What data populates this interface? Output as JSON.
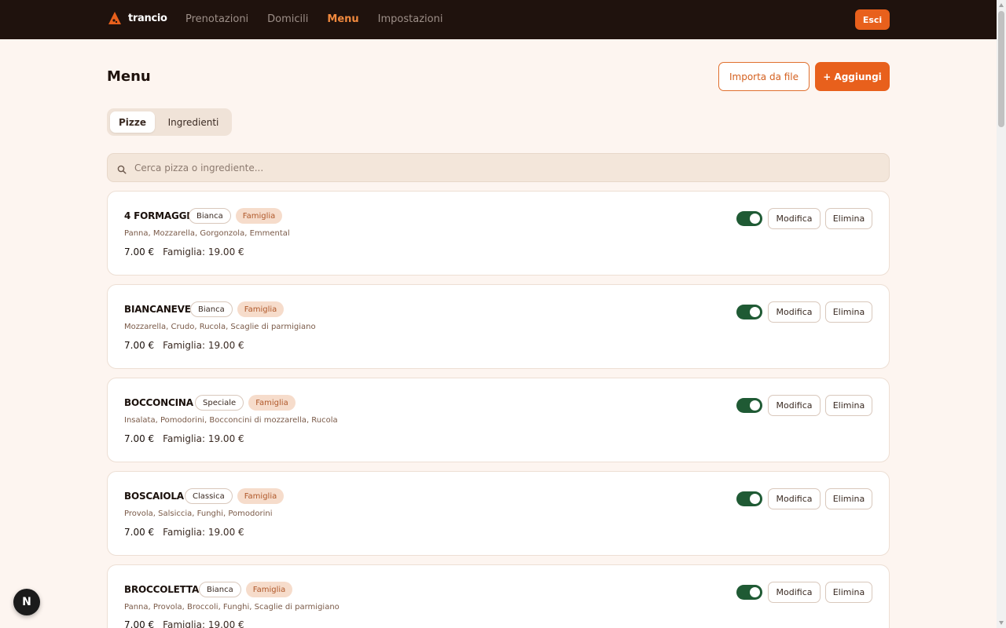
{
  "brand": {
    "name": "trancio",
    "accent": "#e8601c"
  },
  "nav": {
    "items": [
      {
        "label": "Prenotazioni",
        "active": false
      },
      {
        "label": "Domicili",
        "active": false
      },
      {
        "label": "Menu",
        "active": true
      },
      {
        "label": "Impostazioni",
        "active": false
      }
    ],
    "logout_label": "Esci"
  },
  "page": {
    "title": "Menu",
    "import_label": "Importa da file",
    "add_label": "+ Aggiungi"
  },
  "tabs": [
    {
      "label": "Pizze",
      "selected": true
    },
    {
      "label": "Ingredienti",
      "selected": false
    }
  ],
  "search": {
    "placeholder": "Cerca pizza o ingrediente...",
    "value": ""
  },
  "pizzas": [
    {
      "name": "4 FORMAGGI",
      "category": "Bianca",
      "family_badge": "Famiglia",
      "ingredients": "Panna, Mozzarella, Gorgonzola, Emmental",
      "price": "7.00 €",
      "family_price": "Famiglia: 19.00 €",
      "enabled": true,
      "edit_label": "Modifica",
      "delete_label": "Elimina"
    },
    {
      "name": "BIANCANEVE",
      "category": "Bianca",
      "family_badge": "Famiglia",
      "ingredients": "Mozzarella, Crudo, Rucola, Scaglie di parmigiano",
      "price": "7.00 €",
      "family_price": "Famiglia: 19.00 €",
      "enabled": true,
      "edit_label": "Modifica",
      "delete_label": "Elimina"
    },
    {
      "name": "BOCCONCINA",
      "category": "Speciale",
      "family_badge": "Famiglia",
      "ingredients": "Insalata, Pomodorini, Bocconcini di mozzarella, Rucola",
      "price": "7.00 €",
      "family_price": "Famiglia: 19.00 €",
      "enabled": true,
      "edit_label": "Modifica",
      "delete_label": "Elimina"
    },
    {
      "name": "BOSCAIOLA",
      "category": "Classica",
      "family_badge": "Famiglia",
      "ingredients": "Provola, Salsiccia, Funghi, Pomodorini",
      "price": "7.00 €",
      "family_price": "Famiglia: 19.00 €",
      "enabled": true,
      "edit_label": "Modifica",
      "delete_label": "Elimina"
    },
    {
      "name": "BROCCOLETTA",
      "category": "Bianca",
      "family_badge": "Famiglia",
      "ingredients": "Panna, Provola, Broccoli, Funghi, Scaglie di parmigiano",
      "price": "7.00 €",
      "family_price": "Famiglia: 19.00 €",
      "enabled": true,
      "edit_label": "Modifica",
      "delete_label": "Elimina"
    }
  ],
  "fab": {
    "label": "N"
  }
}
